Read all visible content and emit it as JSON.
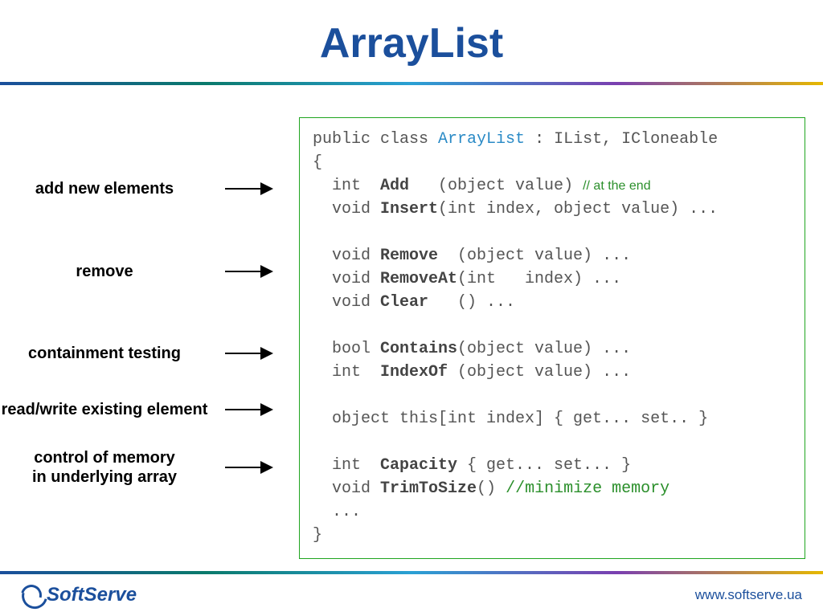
{
  "title": "ArrayList",
  "labels": {
    "add": "add new elements",
    "remove": "remove",
    "contain": "containment testing",
    "readwrite": "read/write existing element",
    "memory1": "control of memory",
    "memory2": "in underlying array"
  },
  "code": {
    "l1a": "public class ",
    "l1b": "ArrayList",
    "l1c": " : IList, ICloneable",
    "l2": "{",
    "l3a": "  int  ",
    "l3b": "Add",
    "l3c": "   (object value) ",
    "l3d": "// at the end",
    "l4a": "  void ",
    "l4b": "Insert",
    "l4c": "(int index, object value) ...",
    "l5": "",
    "l6a": "  void ",
    "l6b": "Remove",
    "l6c": "  (object value) ...",
    "l7a": "  void ",
    "l7b": "RemoveAt",
    "l7c": "(int   index) ...",
    "l8a": "  void ",
    "l8b": "Clear",
    "l8c": "   () ...",
    "l9": "",
    "l10a": "  bool ",
    "l10b": "Contains",
    "l10c": "(object value) ...",
    "l11a": "  int  ",
    "l11b": "IndexOf",
    "l11c": " (object value) ...",
    "l12": "",
    "l13a": "  object this[int index] { get... set.. }",
    "l14": "",
    "l15a": "  int  ",
    "l15b": "Capacity",
    "l15c": " { get... set... }",
    "l16a": "  void ",
    "l16b": "TrimToSize",
    "l16c": "() ",
    "l16d": "//minimize memory",
    "l17": "  ...",
    "l18": "}"
  },
  "footer": {
    "brand": "SoftServe",
    "url": "www.softserve.ua"
  }
}
